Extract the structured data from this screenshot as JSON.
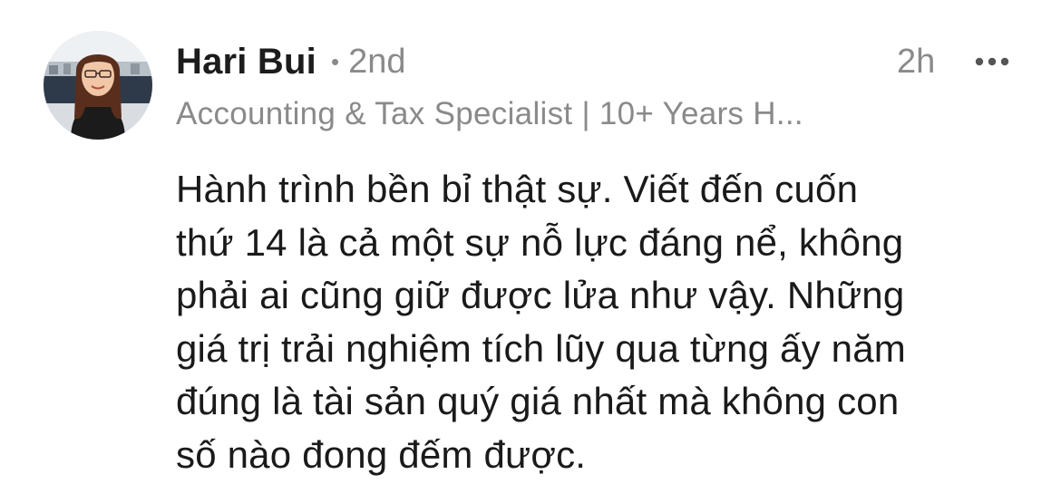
{
  "comment": {
    "author": {
      "name": "Hari Bui",
      "separator": "•",
      "connection_degree": "2nd",
      "headline": "Accounting & Tax Specialist | 10+ Years H...",
      "avatar_icon": "profile-photo"
    },
    "timestamp": "2h",
    "more_icon": "more-horizontal-icon",
    "body_lines": [
      "Hành trình bền bỉ thật sự. Viết đến cuốn",
      "thứ 14 là cả một sự nỗ lực đáng nể, không",
      "phải ai cũng giữ được lửa như vậy. Những",
      "giá trị trải nghiệm tích lũy qua từng ấy năm",
      "đúng là tài sản quý giá nhất mà không con",
      "số nào đong đếm được."
    ]
  },
  "colors": {
    "name": "#1c1c1c",
    "secondary": "#8a8a8a",
    "body": "#1a1a1a",
    "background": "#ffffff"
  }
}
